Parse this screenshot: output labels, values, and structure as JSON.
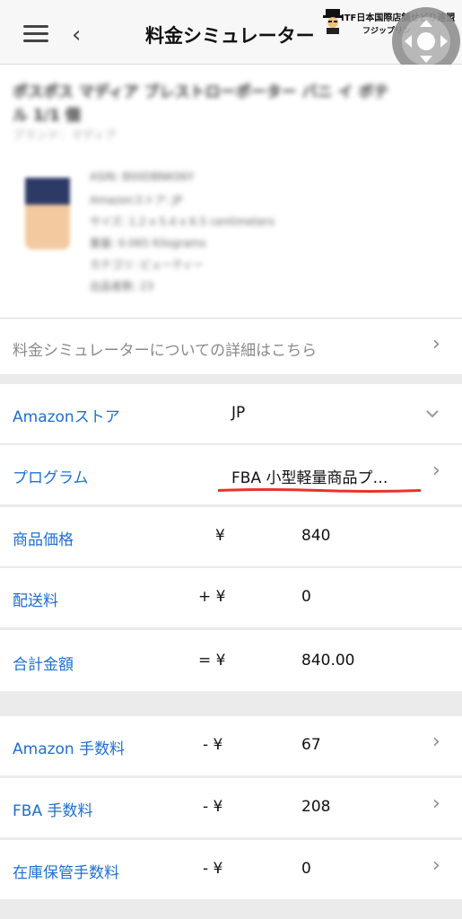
{
  "header": {
    "title": "料金シミュレーター",
    "watermark_line1": "ITF日本国際店舗せどり連盟",
    "watermark_line2": "フジップリン"
  },
  "product": {
    "name_line1": "ポスポス マディア ブレストローポーター バニ イ ボテ",
    "name_line2": "ル 1/1 個",
    "brand": "ブランド：マディア",
    "details": [
      "ASIN: B00DBNK06Y",
      "Amazonストア: JP",
      "サイズ: 1.2 x 5.4 x 6.5 centimeters",
      "重量: 0.065 Kilograms",
      "カテゴリ: ビューティー",
      "出品者数: 23"
    ]
  },
  "link_row": {
    "label": "料金シミュレーターについての詳細はこちら"
  },
  "store": {
    "label": "Amazonストア",
    "value": "JP"
  },
  "program": {
    "label": "プログラム",
    "value": "FBA 小型軽量商品プ…"
  },
  "price": {
    "label": "商品価格",
    "symbol": "¥",
    "value": "840"
  },
  "shipping": {
    "label": "配送料",
    "symbol": "+ ¥",
    "value": "0"
  },
  "total": {
    "label": "合計金額",
    "symbol": "= ¥",
    "value": "840.00"
  },
  "fees": [
    {
      "label": "Amazon 手数料",
      "symbol": "- ¥",
      "value": "67"
    },
    {
      "label": "FBA 手数料",
      "symbol": "- ¥",
      "value": "208"
    },
    {
      "label": "在庫保管手数料",
      "symbol": "- ¥",
      "value": "0"
    }
  ],
  "colors": {
    "label_blue": "#1e6fd1",
    "underline_red": "#e8332a"
  },
  "icons": [
    "menu-icon",
    "back-icon",
    "chevron-right-icon",
    "chevron-down-icon",
    "assistive-touch-icon"
  ]
}
